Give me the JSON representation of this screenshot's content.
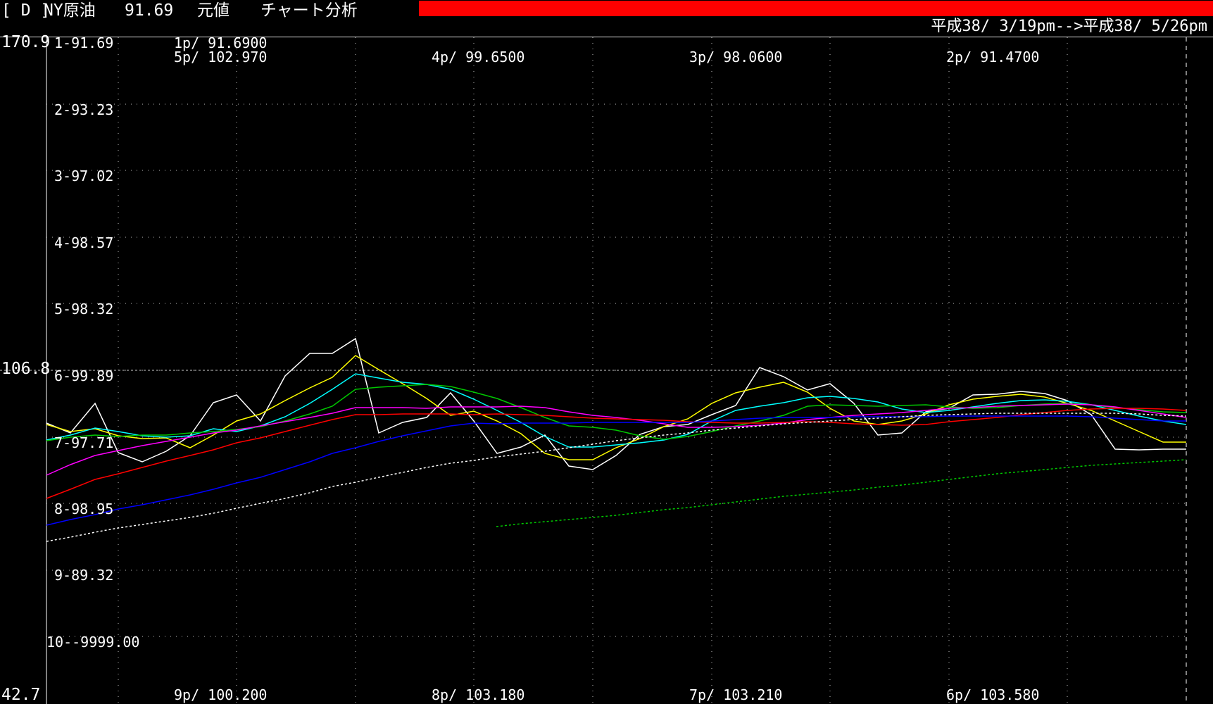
{
  "title": {
    "mode": "[ D ]",
    "instrument": "NY原油",
    "price": "91.69",
    "value_type": "元値",
    "app_name": "チャート分析"
  },
  "date_range": "平成38/ 3/19pm-->平成38/ 5/26pm",
  "y_scale": {
    "top": "170.9",
    "mid": "106.8",
    "bottom": "42.7"
  },
  "legend": [
    "1-91.69",
    "2-93.23",
    "3-97.02",
    "4-98.57",
    "5-98.32",
    "6-99.89",
    "7-97.71",
    "8-98.95",
    "9-89.32",
    "10--9999.00"
  ],
  "top_labels": [
    "1p/ 91.6900",
    "5p/ 102.970",
    "4p/ 99.6500",
    "3p/ 98.0600",
    "2p/ 91.4700"
  ],
  "bottom_labels": [
    "9p/ 100.200",
    "8p/ 103.180",
    "7p/ 103.210",
    "6p/ 103.580"
  ],
  "colors": {
    "background": "#000000",
    "title_accent": "#ff0000",
    "grid": "#bbbbbb",
    "series": [
      "#ffffff",
      "#ffff00",
      "#00ffff",
      "#00c800",
      "#ff00ff",
      "#ff0000",
      "#0000ff",
      "#ffffff",
      "#00c800"
    ]
  }
}
